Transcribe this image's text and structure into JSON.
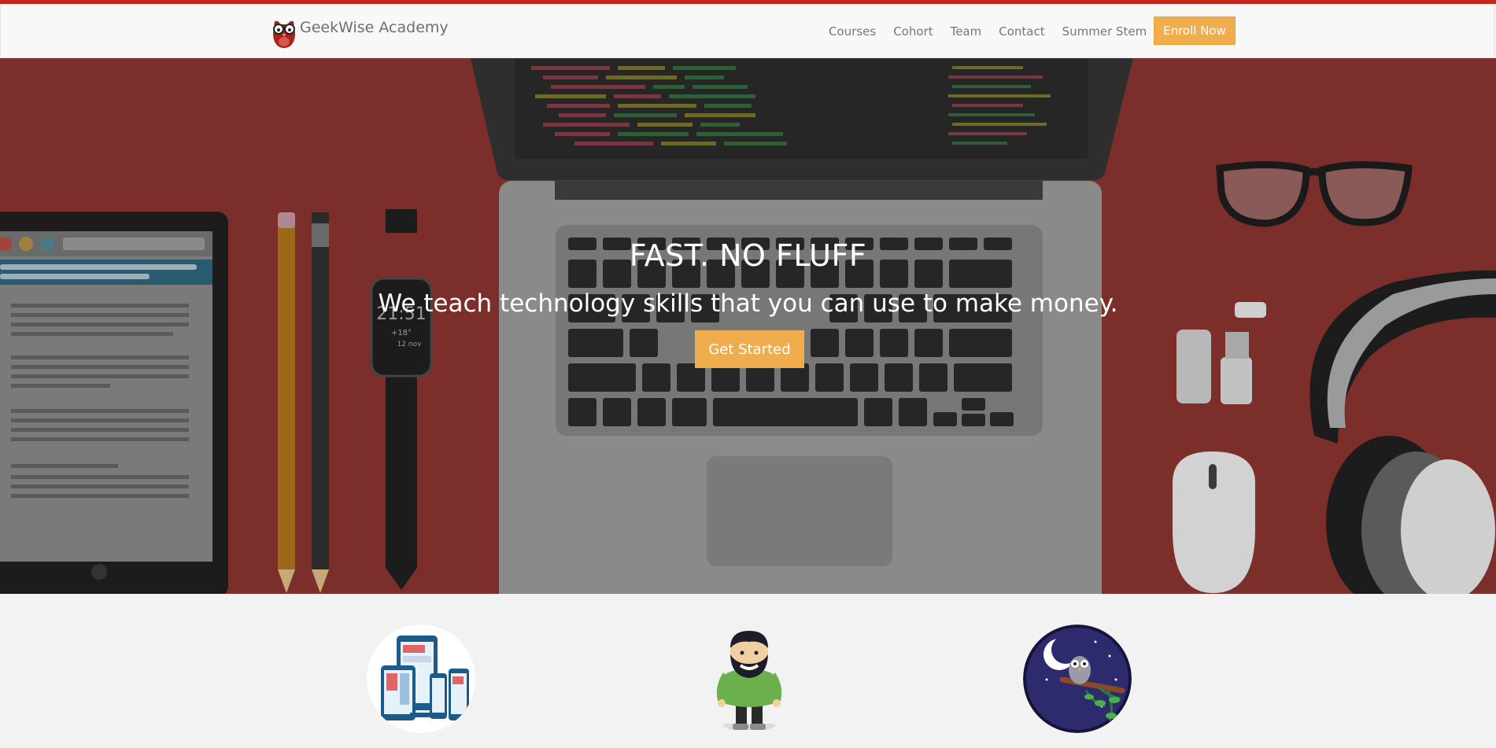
{
  "brand": {
    "name": "GeekWise Academy",
    "logo_icon": "owl-glasses-icon"
  },
  "nav": {
    "links": [
      "Courses",
      "Cohort",
      "Team",
      "Contact",
      "Summer Stem"
    ],
    "enroll_label": "Enroll Now"
  },
  "hero": {
    "title": "FAST. NO FLUFF",
    "subtitle": "We teach technology skills that you can use to make money.",
    "cta_label": "Get Started",
    "watch_time": "21:51",
    "watch_temp": "+18°",
    "watch_date": "12 nov"
  },
  "features": [
    {
      "icon": "responsive-devices-icon"
    },
    {
      "icon": "bearded-man-icon"
    },
    {
      "icon": "night-owl-icon"
    }
  ],
  "colors": {
    "accent_red": "#c4261d",
    "hero_bg": "#7c2e2a",
    "button_orange": "#f0ad4e",
    "navbar_bg": "#f8f8f8"
  }
}
